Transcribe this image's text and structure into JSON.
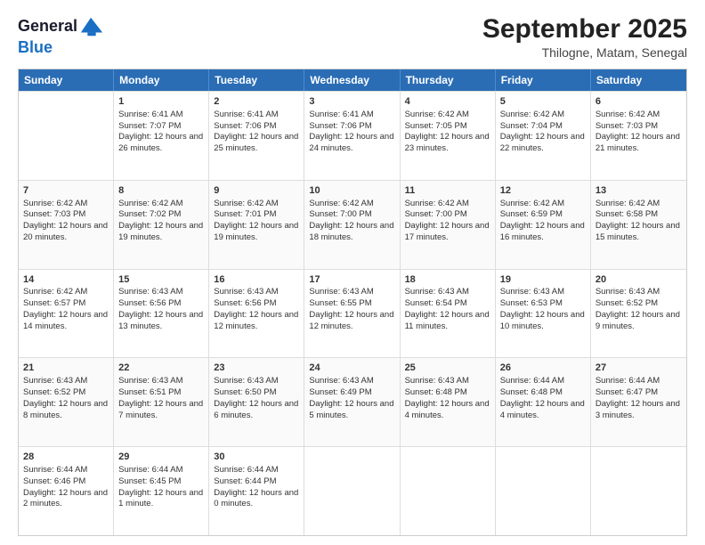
{
  "logo": {
    "general": "General",
    "blue": "Blue"
  },
  "title": "September 2025",
  "subtitle": "Thilogne, Matam, Senegal",
  "header_days": [
    "Sunday",
    "Monday",
    "Tuesday",
    "Wednesday",
    "Thursday",
    "Friday",
    "Saturday"
  ],
  "weeks": [
    [
      {
        "day": "",
        "info": ""
      },
      {
        "day": "1",
        "info": "Sunrise: 6:41 AM\nSunset: 7:07 PM\nDaylight: 12 hours and 26 minutes."
      },
      {
        "day": "2",
        "info": "Sunrise: 6:41 AM\nSunset: 7:06 PM\nDaylight: 12 hours and 25 minutes."
      },
      {
        "day": "3",
        "info": "Sunrise: 6:41 AM\nSunset: 7:06 PM\nDaylight: 12 hours and 24 minutes."
      },
      {
        "day": "4",
        "info": "Sunrise: 6:42 AM\nSunset: 7:05 PM\nDaylight: 12 hours and 23 minutes."
      },
      {
        "day": "5",
        "info": "Sunrise: 6:42 AM\nSunset: 7:04 PM\nDaylight: 12 hours and 22 minutes."
      },
      {
        "day": "6",
        "info": "Sunrise: 6:42 AM\nSunset: 7:03 PM\nDaylight: 12 hours and 21 minutes."
      }
    ],
    [
      {
        "day": "7",
        "info": "Sunrise: 6:42 AM\nSunset: 7:03 PM\nDaylight: 12 hours and 20 minutes."
      },
      {
        "day": "8",
        "info": "Sunrise: 6:42 AM\nSunset: 7:02 PM\nDaylight: 12 hours and 19 minutes."
      },
      {
        "day": "9",
        "info": "Sunrise: 6:42 AM\nSunset: 7:01 PM\nDaylight: 12 hours and 19 minutes."
      },
      {
        "day": "10",
        "info": "Sunrise: 6:42 AM\nSunset: 7:00 PM\nDaylight: 12 hours and 18 minutes."
      },
      {
        "day": "11",
        "info": "Sunrise: 6:42 AM\nSunset: 7:00 PM\nDaylight: 12 hours and 17 minutes."
      },
      {
        "day": "12",
        "info": "Sunrise: 6:42 AM\nSunset: 6:59 PM\nDaylight: 12 hours and 16 minutes."
      },
      {
        "day": "13",
        "info": "Sunrise: 6:42 AM\nSunset: 6:58 PM\nDaylight: 12 hours and 15 minutes."
      }
    ],
    [
      {
        "day": "14",
        "info": "Sunrise: 6:42 AM\nSunset: 6:57 PM\nDaylight: 12 hours and 14 minutes."
      },
      {
        "day": "15",
        "info": "Sunrise: 6:43 AM\nSunset: 6:56 PM\nDaylight: 12 hours and 13 minutes."
      },
      {
        "day": "16",
        "info": "Sunrise: 6:43 AM\nSunset: 6:56 PM\nDaylight: 12 hours and 12 minutes."
      },
      {
        "day": "17",
        "info": "Sunrise: 6:43 AM\nSunset: 6:55 PM\nDaylight: 12 hours and 12 minutes."
      },
      {
        "day": "18",
        "info": "Sunrise: 6:43 AM\nSunset: 6:54 PM\nDaylight: 12 hours and 11 minutes."
      },
      {
        "day": "19",
        "info": "Sunrise: 6:43 AM\nSunset: 6:53 PM\nDaylight: 12 hours and 10 minutes."
      },
      {
        "day": "20",
        "info": "Sunrise: 6:43 AM\nSunset: 6:52 PM\nDaylight: 12 hours and 9 minutes."
      }
    ],
    [
      {
        "day": "21",
        "info": "Sunrise: 6:43 AM\nSunset: 6:52 PM\nDaylight: 12 hours and 8 minutes."
      },
      {
        "day": "22",
        "info": "Sunrise: 6:43 AM\nSunset: 6:51 PM\nDaylight: 12 hours and 7 minutes."
      },
      {
        "day": "23",
        "info": "Sunrise: 6:43 AM\nSunset: 6:50 PM\nDaylight: 12 hours and 6 minutes."
      },
      {
        "day": "24",
        "info": "Sunrise: 6:43 AM\nSunset: 6:49 PM\nDaylight: 12 hours and 5 minutes."
      },
      {
        "day": "25",
        "info": "Sunrise: 6:43 AM\nSunset: 6:48 PM\nDaylight: 12 hours and 4 minutes."
      },
      {
        "day": "26",
        "info": "Sunrise: 6:44 AM\nSunset: 6:48 PM\nDaylight: 12 hours and 4 minutes."
      },
      {
        "day": "27",
        "info": "Sunrise: 6:44 AM\nSunset: 6:47 PM\nDaylight: 12 hours and 3 minutes."
      }
    ],
    [
      {
        "day": "28",
        "info": "Sunrise: 6:44 AM\nSunset: 6:46 PM\nDaylight: 12 hours and 2 minutes."
      },
      {
        "day": "29",
        "info": "Sunrise: 6:44 AM\nSunset: 6:45 PM\nDaylight: 12 hours and 1 minute."
      },
      {
        "day": "30",
        "info": "Sunrise: 6:44 AM\nSunset: 6:44 PM\nDaylight: 12 hours and 0 minutes."
      },
      {
        "day": "",
        "info": ""
      },
      {
        "day": "",
        "info": ""
      },
      {
        "day": "",
        "info": ""
      },
      {
        "day": "",
        "info": ""
      }
    ]
  ]
}
